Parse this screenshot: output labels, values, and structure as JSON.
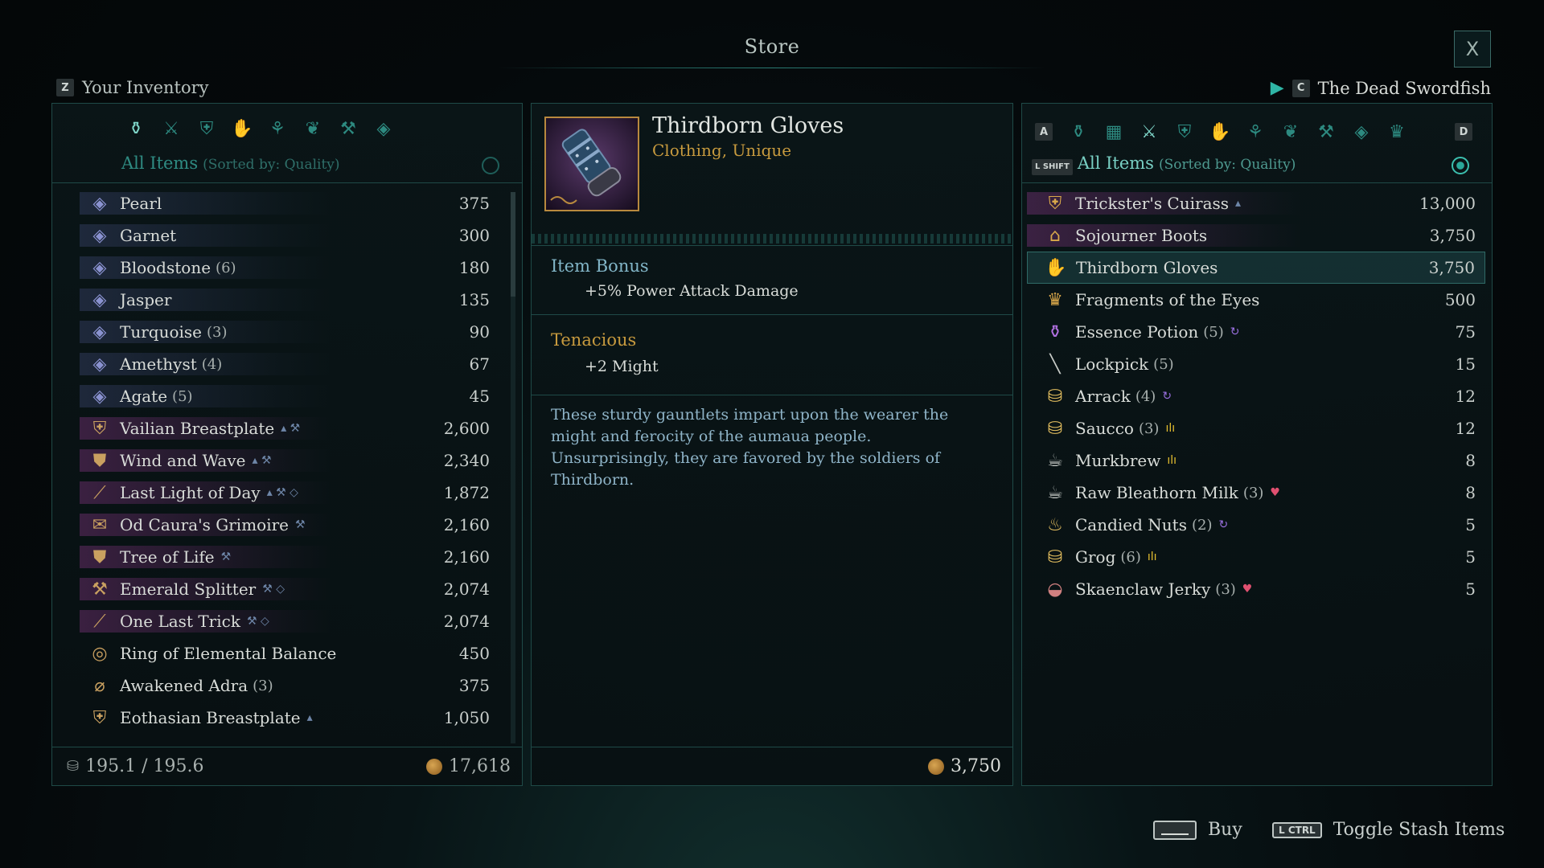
{
  "window": {
    "title": "Store",
    "close_label": "X"
  },
  "left": {
    "key": "Z",
    "title": "Your Inventory",
    "category_icons": [
      "bag-icon",
      "weapons-icon",
      "armor-icon",
      "clothing-icon",
      "accessories-icon",
      "consumables-icon",
      "crafting-icon",
      "gems-icon"
    ],
    "filter_label": "All Items",
    "sort_label": "(Sorted by: Quality)",
    "items": [
      {
        "name": "Pearl",
        "qty": "",
        "tags": "",
        "value": "375",
        "icon": "gem-icon",
        "glyph": "◈",
        "color": "#8a92d0",
        "band": "gem",
        "side": ""
      },
      {
        "name": "Garnet",
        "qty": "",
        "tags": "",
        "value": "300",
        "icon": "gem-icon",
        "glyph": "◈",
        "color": "#8a92d0",
        "band": "gem",
        "side": ""
      },
      {
        "name": "Bloodstone",
        "qty": "(6)",
        "tags": "",
        "value": "180",
        "icon": "gem-icon",
        "glyph": "◈",
        "color": "#8a92d0",
        "band": "gem",
        "side": ""
      },
      {
        "name": "Jasper",
        "qty": "",
        "tags": "",
        "value": "135",
        "icon": "gem-icon",
        "glyph": "◈",
        "color": "#8a92d0",
        "band": "gem",
        "side": ""
      },
      {
        "name": "Turquoise",
        "qty": "(3)",
        "tags": "",
        "value": "90",
        "icon": "gem-icon",
        "glyph": "◈",
        "color": "#8a92d0",
        "band": "gem",
        "side": ""
      },
      {
        "name": "Amethyst",
        "qty": "(4)",
        "tags": "",
        "value": "67",
        "icon": "gem-icon",
        "glyph": "◈",
        "color": "#8a92d0",
        "band": "gem",
        "side": ""
      },
      {
        "name": "Agate",
        "qty": "(5)",
        "tags": "",
        "value": "45",
        "icon": "gem-icon",
        "glyph": "◈",
        "color": "#8a92d0",
        "band": "gem",
        "side": ""
      },
      {
        "name": "Vailian Breastplate",
        "qty": "",
        "tags": "▴ ⚒",
        "value": "2,600",
        "icon": "breastplate-icon",
        "glyph": "⛨",
        "color": "#c9a060",
        "band": "unique",
        "side": "◈"
      },
      {
        "name": "Wind and Wave",
        "qty": "",
        "tags": "▴ ⚒",
        "value": "2,340",
        "icon": "shield-icon",
        "glyph": "⛊",
        "color": "#c9a060",
        "band": "unique",
        "side": "◈"
      },
      {
        "name": "Last Light of Day",
        "qty": "",
        "tags": "▴ ⚒ ◇",
        "value": "1,872",
        "icon": "sword-icon",
        "glyph": "⟋",
        "color": "#c9a060",
        "band": "unique",
        "side": "◈"
      },
      {
        "name": "Od Caura's Grimoire",
        "qty": "",
        "tags": "⚒",
        "value": "2,160",
        "icon": "grimoire-icon",
        "glyph": "✉",
        "color": "#c9a060",
        "band": "unique",
        "side": ""
      },
      {
        "name": "Tree of Life",
        "qty": "",
        "tags": "⚒",
        "value": "2,160",
        "icon": "shield-icon",
        "glyph": "⛊",
        "color": "#c9a060",
        "band": "unique",
        "side": ""
      },
      {
        "name": "Emerald Splitter",
        "qty": "",
        "tags": "⚒ ◇",
        "value": "2,074",
        "icon": "axe-icon",
        "glyph": "⚒",
        "color": "#c9a060",
        "band": "unique",
        "side": ""
      },
      {
        "name": "One Last Trick",
        "qty": "",
        "tags": "⚒ ◇",
        "value": "2,074",
        "icon": "sword-icon",
        "glyph": "⟋",
        "color": "#c9a060",
        "band": "unique",
        "side": ""
      },
      {
        "name": "Ring of Elemental Balance",
        "qty": "",
        "tags": "",
        "value": "450",
        "icon": "ring-icon",
        "glyph": "◎",
        "color": "#c9a060",
        "band": "",
        "side": ""
      },
      {
        "name": "Awakened Adra",
        "qty": "(3)",
        "tags": "",
        "value": "375",
        "icon": "adra-icon",
        "glyph": "⌀",
        "color": "#c9a060",
        "band": "",
        "side": ""
      },
      {
        "name": "Eothasian Breastplate",
        "qty": "",
        "tags": "▴",
        "value": "1,050",
        "icon": "breastplate-icon",
        "glyph": "⛨",
        "color": "#c9a060",
        "band": "",
        "side": ""
      }
    ],
    "weight": "195.1 / 195.6",
    "money": "17,618"
  },
  "detail": {
    "name": "Thirdborn Gloves",
    "type": "Clothing, Unique",
    "bonus_title": "Item Bonus",
    "bonus_value": "+5% Power Attack Damage",
    "trait_title": "Tenacious",
    "trait_value": "+2 Might",
    "description": "These sturdy gauntlets impart upon the wearer the might and ferocity of the aumaua people. Unsurprisingly, they are favored by the soldiers of Thirdborn.",
    "price": "3,750"
  },
  "right": {
    "key": "C",
    "title": "The Dead Swordfish",
    "prev_key": "A",
    "next_key": "D",
    "category_icons": [
      "bag-icon",
      "stash-icon",
      "weapons-icon",
      "armor-icon",
      "clothing-icon",
      "accessories-icon",
      "consumables-icon",
      "crafting-icon",
      "gems-icon",
      "crown-icon"
    ],
    "filter_key": "L SHIFT",
    "filter_label": "All Items",
    "sort_label": "(Sorted by: Quality)",
    "items": [
      {
        "name": "Trickster's Cuirass",
        "qty": "",
        "tags": "▴",
        "value": "13,000",
        "icon": "cuirass-icon",
        "glyph": "⛨",
        "color": "#d9a84a",
        "band": "unique",
        "selected": false
      },
      {
        "name": "Sojourner Boots",
        "qty": "",
        "tags": "",
        "value": "3,750",
        "icon": "boots-icon",
        "glyph": "⌂",
        "color": "#d9a84a",
        "band": "unique",
        "selected": false
      },
      {
        "name": "Thirdborn Gloves",
        "qty": "",
        "tags": "",
        "value": "3,750",
        "icon": "glove-icon",
        "glyph": "✋",
        "color": "#d9a84a",
        "band": "",
        "selected": true
      },
      {
        "name": "Fragments of the Eyes",
        "qty": "",
        "tags": "",
        "value": "500",
        "icon": "crown-icon",
        "glyph": "♛",
        "color": "#d9a84a",
        "band": "",
        "selected": false
      },
      {
        "name": "Essence Potion",
        "qty": "(5)",
        "tags": "↻",
        "value": "75",
        "icon": "potion-icon",
        "glyph": "⚱",
        "color": "#b070e0",
        "band": "",
        "selected": false
      },
      {
        "name": "Lockpick",
        "qty": "(5)",
        "tags": "",
        "value": "15",
        "icon": "lockpick-icon",
        "glyph": "╲",
        "color": "#c8ccc8",
        "band": "",
        "selected": false
      },
      {
        "name": "Arrack",
        "qty": "(4)",
        "tags": "↻",
        "value": "12",
        "icon": "drink-icon",
        "glyph": "⛁",
        "color": "#e6c060",
        "band": "",
        "selected": false
      },
      {
        "name": "Saucco",
        "qty": "(3)",
        "tags": "ılı",
        "value": "12",
        "icon": "drink-icon",
        "glyph": "⛁",
        "color": "#e6c060",
        "band": "",
        "selected": false
      },
      {
        "name": "Murkbrew",
        "qty": "",
        "tags": "ılı",
        "value": "8",
        "icon": "cup-icon",
        "glyph": "☕",
        "color": "#c8ccc8",
        "band": "",
        "selected": false
      },
      {
        "name": "Raw Bleathorn Milk",
        "qty": "(3)",
        "tags": "♥",
        "value": "8",
        "icon": "cup-icon",
        "glyph": "☕",
        "color": "#c8ccc8",
        "band": "",
        "selected": false
      },
      {
        "name": "Candied Nuts",
        "qty": "(2)",
        "tags": "↻",
        "value": "5",
        "icon": "food-icon",
        "glyph": "♨",
        "color": "#e6c060",
        "band": "",
        "selected": false
      },
      {
        "name": "Grog",
        "qty": "(6)",
        "tags": "ılı",
        "value": "5",
        "icon": "drink-icon",
        "glyph": "⛁",
        "color": "#e6c060",
        "band": "",
        "selected": false
      },
      {
        "name": "Skaenclaw Jerky",
        "qty": "(3)",
        "tags": "♥",
        "value": "5",
        "icon": "meat-icon",
        "glyph": "◒",
        "color": "#d08080",
        "band": "",
        "selected": false
      }
    ]
  },
  "hints": {
    "buy_label": "Buy",
    "toggle_key": "L CTRL",
    "toggle_label": "Toggle Stash Items"
  }
}
